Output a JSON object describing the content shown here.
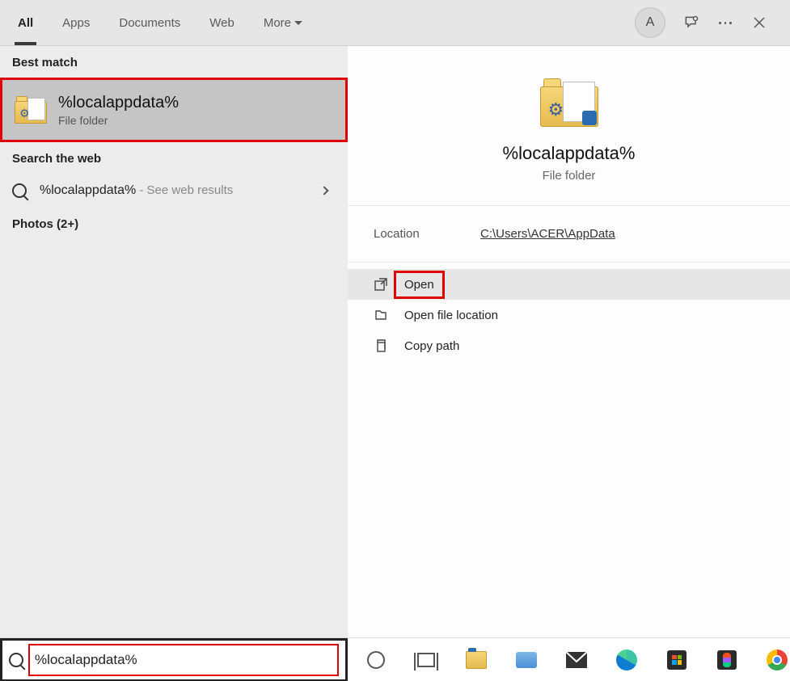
{
  "tabs": {
    "all": "All",
    "apps": "Apps",
    "documents": "Documents",
    "web": "Web",
    "more": "More"
  },
  "avatar_initial": "A",
  "sections": {
    "best_match": "Best match",
    "search_web": "Search the web",
    "photos": "Photos (2+)"
  },
  "best_match": {
    "title": "%localappdata%",
    "subtitle": "File folder"
  },
  "web_result": {
    "query": "%localappdata%",
    "suffix": " - See web results"
  },
  "details": {
    "title": "%localappdata%",
    "subtitle": "File folder",
    "location_label": "Location",
    "location_value": "C:\\Users\\ACER\\AppData"
  },
  "actions": {
    "open": "Open",
    "open_location": "Open file location",
    "copy_path": "Copy path"
  },
  "search_input_value": "%localappdata%"
}
